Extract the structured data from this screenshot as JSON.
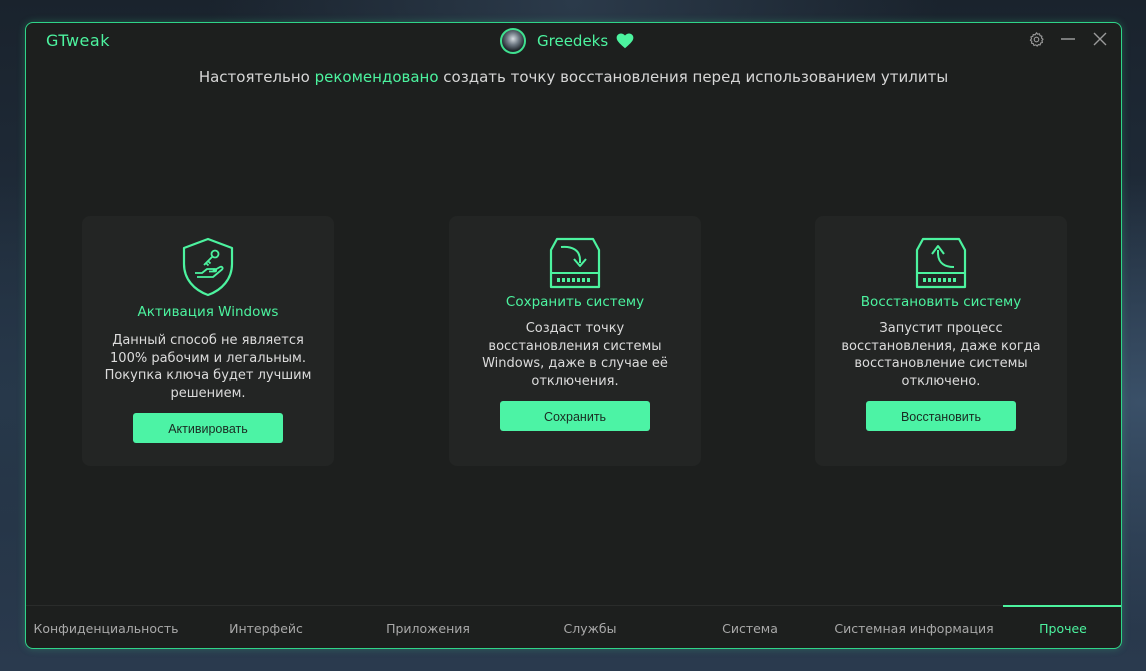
{
  "app": {
    "title": "GTweak"
  },
  "user": {
    "name": "Greedeks",
    "avatar_icon": "avatar",
    "badge_icon": "heart-icon"
  },
  "window_controls": {
    "settings_icon": "gear-icon",
    "minimize_icon": "minimize-icon",
    "close_icon": "close-icon"
  },
  "notice": {
    "before": "Настоятельно ",
    "highlight": "рекомендовано",
    "after": " создать точку восстановления перед использованием утилиты"
  },
  "cards": [
    {
      "icon": "shield-key-icon",
      "title": "Активация Windows",
      "description": "Данный способ не является 100% рабочим и легальным. Покупка ключа будет лучшим решением.",
      "button": "Активировать"
    },
    {
      "icon": "drive-save-icon",
      "title": "Сохранить систему",
      "description": "Создаст точку восстановления системы Windows, даже в случае её отключения.",
      "button": "Сохранить"
    },
    {
      "icon": "drive-restore-icon",
      "title": "Восстановить систему",
      "description": "Запустит процесс восстановления, даже когда восстановление системы отключено.",
      "button": "Восстановить"
    }
  ],
  "nav": {
    "items": [
      "Конфиденциальность",
      "Интерфейс",
      "Приложения",
      "Службы",
      "Система",
      "Системная информация",
      "Прочее"
    ],
    "active": "Прочее"
  },
  "colors": {
    "accent": "#4cf39f",
    "button": "#4cf3a5",
    "window_bg": "#1d1f1e",
    "card_bg": "#232524",
    "border": "#2fd488"
  }
}
